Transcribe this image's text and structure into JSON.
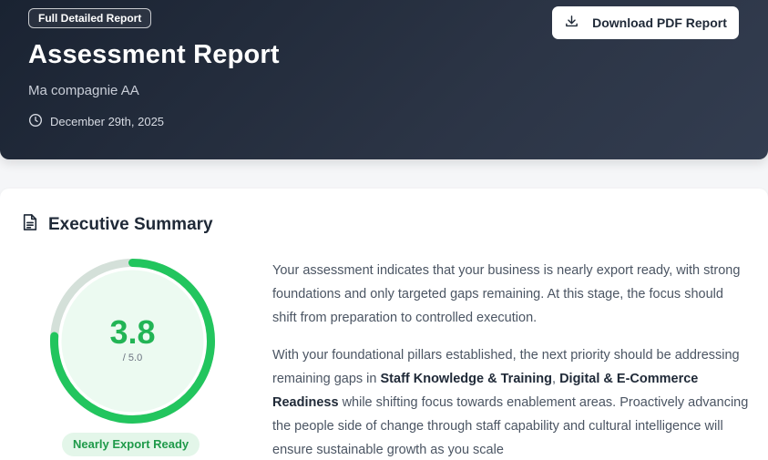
{
  "header": {
    "badge": "Full Detailed Report",
    "title": "Assessment Report",
    "company": "Ma compagnie AA",
    "date": "December 29th, 2025",
    "download_label": "Download PDF Report"
  },
  "executive_summary": {
    "title": "Executive Summary",
    "score": "3.8",
    "score_max": "/ 5.0",
    "score_value": 3.8,
    "score_out_of": 5.0,
    "status": "Nearly Export Ready",
    "paragraph1": "Your assessment indicates that your business is nearly export ready, with strong foundations and only targeted gaps remaining. At this stage, the focus should shift from preparation to controlled execution.",
    "p2_intro": "With your foundational pillars established, the next priority should be addressing remaining gaps in ",
    "gap1": "Staff Knowledge & Training",
    "p2_sep": ", ",
    "gap2": "Digital & E-Commerce Readiness",
    "p2_rest": " while shifting focus towards enablement areas. Proactively advancing the people side of change through staff capability and cultural intelligence will ensure sustainable growth as you scale"
  },
  "colors": {
    "accent_green": "#22c55e",
    "track_gray": "#d4e0d9",
    "header_dark": "#1a2332"
  },
  "icons": {
    "clock": "clock-icon",
    "download": "download-icon",
    "document": "document-icon"
  }
}
